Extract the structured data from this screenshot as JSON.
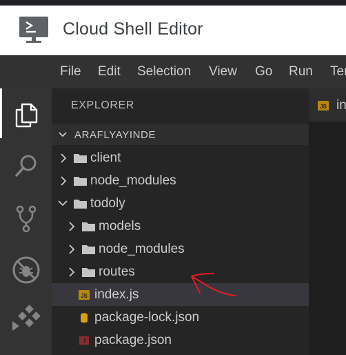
{
  "app": {
    "title": "Cloud Shell Editor"
  },
  "menu": [
    "File",
    "Edit",
    "Selection",
    "View",
    "Go",
    "Run",
    "Terminal"
  ],
  "activity_bar": {
    "items": [
      "explorer",
      "search",
      "source-control",
      "run-debug",
      "extensions"
    ],
    "active": "explorer"
  },
  "explorer": {
    "title": "EXPLORER",
    "section": "ARAFLYAYINDE",
    "tree": [
      {
        "label": "client",
        "type": "folder",
        "expanded": false,
        "depth": 0
      },
      {
        "label": "node_modules",
        "type": "folder",
        "expanded": false,
        "depth": 0
      },
      {
        "label": "todoly",
        "type": "folder",
        "expanded": true,
        "depth": 0
      },
      {
        "label": "models",
        "type": "folder",
        "expanded": false,
        "depth": 1
      },
      {
        "label": "node_modules",
        "type": "folder",
        "expanded": false,
        "depth": 1
      },
      {
        "label": "routes",
        "type": "folder",
        "expanded": false,
        "depth": 1
      },
      {
        "label": "index.js",
        "type": "file-js",
        "selected": true,
        "depth": 1
      },
      {
        "label": "package-lock.json",
        "type": "file-lock",
        "depth": 1
      },
      {
        "label": "package.json",
        "type": "file-npm",
        "depth": 1
      }
    ]
  },
  "editor": {
    "tab": {
      "label": "index.js",
      "icon": "js-file-icon"
    }
  },
  "colors": {
    "menubar": "#323233",
    "activitybar": "#333333",
    "sidebar": "#252526",
    "selection": "#37373d",
    "js_icon": "#cbcb41",
    "annotation": "#e51c23"
  }
}
